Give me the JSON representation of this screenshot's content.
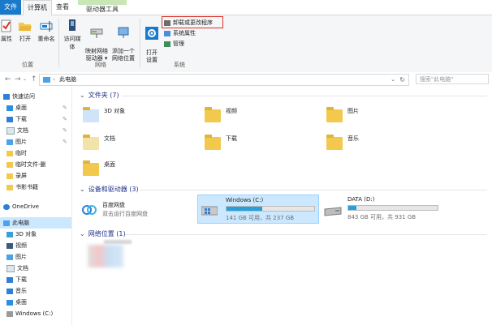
{
  "tabs": {
    "file": "文件",
    "computer": "计算机",
    "view": "查看",
    "drive_tools": "驱动器工具"
  },
  "ribbon": {
    "location": {
      "properties": "属性",
      "open": "打开",
      "rename": "重命名",
      "group": "位置"
    },
    "network": {
      "access_media": "访问媒体",
      "map_drive": "映射网络\n驱动器 ▾",
      "add_location": "添加一个\n网络位置",
      "group": "网络"
    },
    "system": {
      "open_settings": "打开\n设置",
      "uninstall": "卸载或更改程序",
      "sys_properties": "系统属性",
      "manage": "管理",
      "group": "系统"
    }
  },
  "address": {
    "path": "此电脑",
    "search_placeholder": "搜索\"此电脑\""
  },
  "nav": {
    "quick_access": "快速访问",
    "items": [
      "桌面",
      "下载",
      "文档",
      "图片",
      "临时",
      "临时文件-删",
      "录屏",
      "书影书籍"
    ],
    "onedrive": "OneDrive",
    "this_pc": "此电脑",
    "pc_items": [
      "3D 对象",
      "视频",
      "图片",
      "文档",
      "下载",
      "音乐",
      "桌面",
      "Windows (C:)"
    ]
  },
  "content": {
    "folders_header": "文件夹 (7)",
    "folders": [
      "3D 对象",
      "视频",
      "图片",
      "文档",
      "下载",
      "音乐",
      "桌面"
    ],
    "drives_header": "设备和驱动器 (3)",
    "baidu": {
      "name": "百度网盘",
      "sub": "双击运行百度网盘"
    },
    "drive_c": {
      "name": "Windows (C:)",
      "info": "141 GB 可用，共 237 GB",
      "used_fraction": 0.405
    },
    "drive_d": {
      "name": "DATA (D:)",
      "info": "843 GB 可用，共 931 GB",
      "used_fraction": 0.095
    },
    "network_header": "网络位置 (1)"
  }
}
